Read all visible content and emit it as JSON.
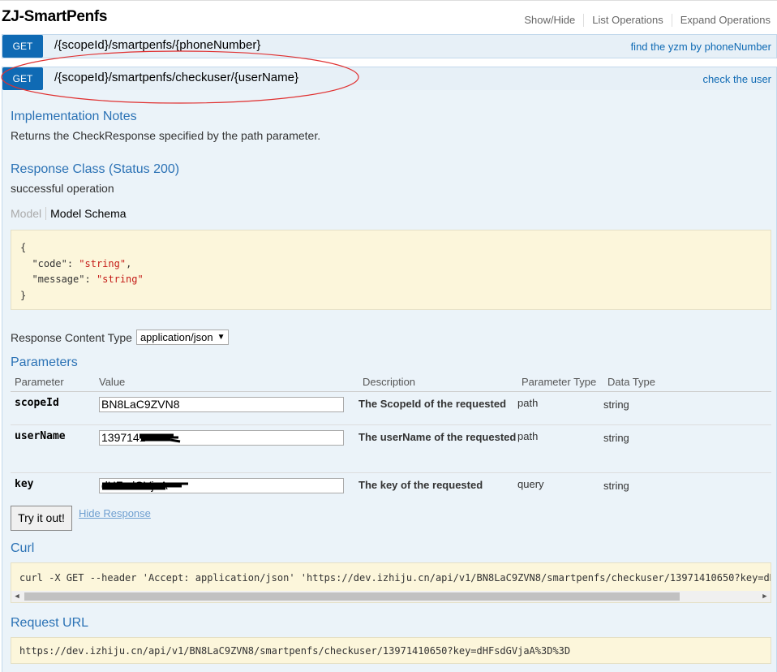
{
  "header": {
    "title": "ZJ-SmartPenfs",
    "links": [
      "Show/Hide",
      "List Operations",
      "Expand Operations"
    ]
  },
  "operations": [
    {
      "method": "GET",
      "path": "/{scopeId}/smartpenfs/{phoneNumber}",
      "summary": "find the yzm by phoneNumber"
    },
    {
      "method": "GET",
      "path": "/{scopeId}/smartpenfs/checkuser/{userName}",
      "summary": "check the user"
    }
  ],
  "details": {
    "impl_title": "Implementation Notes",
    "impl_text": "Returns the CheckResponse specified by the path parameter.",
    "resp_class_title": "Response Class (Status 200)",
    "resp_class_text": "successful operation",
    "model_tab": "Model",
    "schema_tab": "Model Schema",
    "schema": {
      "open": "{",
      "code_key": "\"code\"",
      "code_val": "\"string\"",
      "message_key": "\"message\"",
      "message_val": "\"string\"",
      "close": "}"
    },
    "content_type_label": "Response Content Type",
    "content_type_value": "application/json",
    "params_title": "Parameters",
    "param_headers": [
      "Parameter",
      "Value",
      "Description",
      "Parameter Type",
      "Data Type"
    ],
    "params": [
      {
        "name": "scopeId",
        "value": "BN8LaC9ZVN8",
        "desc": "The ScopeId of the requested",
        "ptype": "path",
        "dtype": "string"
      },
      {
        "name": "userName",
        "value": "1397141",
        "desc": "The userName of the requested",
        "ptype": "path",
        "dtype": "string"
      },
      {
        "name": "key",
        "value": "dHFsdGVjaA",
        "desc": "The key of the requested",
        "ptype": "query",
        "dtype": "string"
      }
    ],
    "try_button": "Try it out!",
    "hide_response": "Hide Response",
    "curl_title": "Curl",
    "curl_text": "curl -X GET --header 'Accept: application/json' 'https://dev.izhiju.cn/api/v1/BN8LaC9ZVN8/smartpenfs/checkuser/13971410650?key=dHF",
    "request_url_title": "Request URL",
    "request_url": "https://dev.izhiju.cn/api/v1/BN8LaC9ZVN8/smartpenfs/checkuser/13971410650?key=dHFsdGVjaA%3D%3D"
  },
  "colors": {
    "get_badge": "#0f6ab4",
    "op_background": "#e7f0f7",
    "section_title": "#2b72b5",
    "code_background": "#fcf6db",
    "annotation_ellipse": "#e03030"
  }
}
